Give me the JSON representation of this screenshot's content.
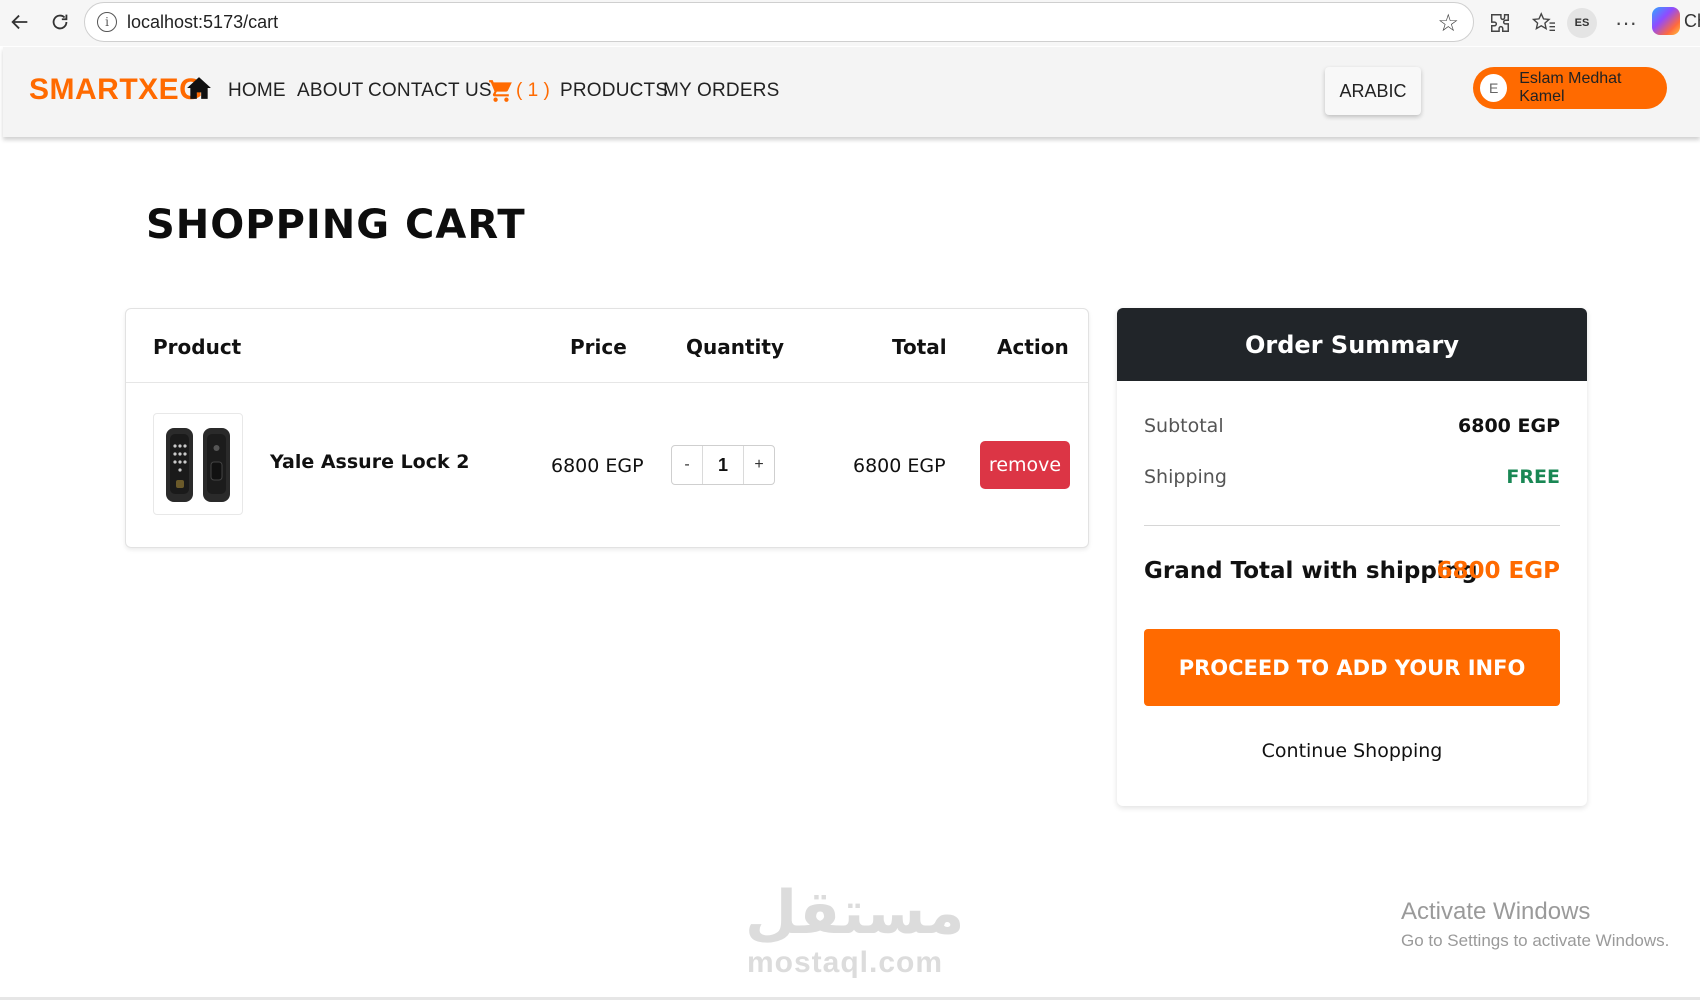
{
  "browser": {
    "url": "localhost:5173/cart",
    "profile_initials": "ES",
    "more_label": "···",
    "tab_fragment": "Ch"
  },
  "header": {
    "brand": "SMARTXEG",
    "nav": [
      "HOME",
      "ABOUT",
      "CONTACT US",
      "PRODUCTS",
      "MY ORDERS"
    ],
    "cart_count": "( 1 )",
    "language_button": "ARABIC",
    "user_initial": "E",
    "user_name": "Eslam Medhat Kamel",
    "accent_color": "#ff6a00"
  },
  "page": {
    "title": "SHOPPING CART"
  },
  "cart": {
    "columns": [
      "Product",
      "Price",
      "Quantity",
      "Total",
      "Action"
    ],
    "items": [
      {
        "name": "Yale Assure Lock 2",
        "price": "6800 EGP",
        "quantity": "1",
        "decrement": "-",
        "increment": "+",
        "total": "6800 EGP",
        "action": "remove"
      }
    ]
  },
  "summary": {
    "title": "Order Summary",
    "subtotal_label": "Subtotal",
    "subtotal_value": "6800 EGP",
    "shipping_label": "Shipping",
    "shipping_value": "FREE",
    "grand_total_label": "Grand Total with shipping",
    "grand_total_value": "6800 EGP",
    "proceed_button": "PROCEED TO ADD YOUR INFO",
    "continue_link": "Continue Shopping"
  },
  "watermarks": {
    "arabic": "مستقل",
    "latin": "mostaql.com",
    "activate_title": "Activate Windows",
    "activate_sub": "Go to Settings to activate Windows."
  }
}
